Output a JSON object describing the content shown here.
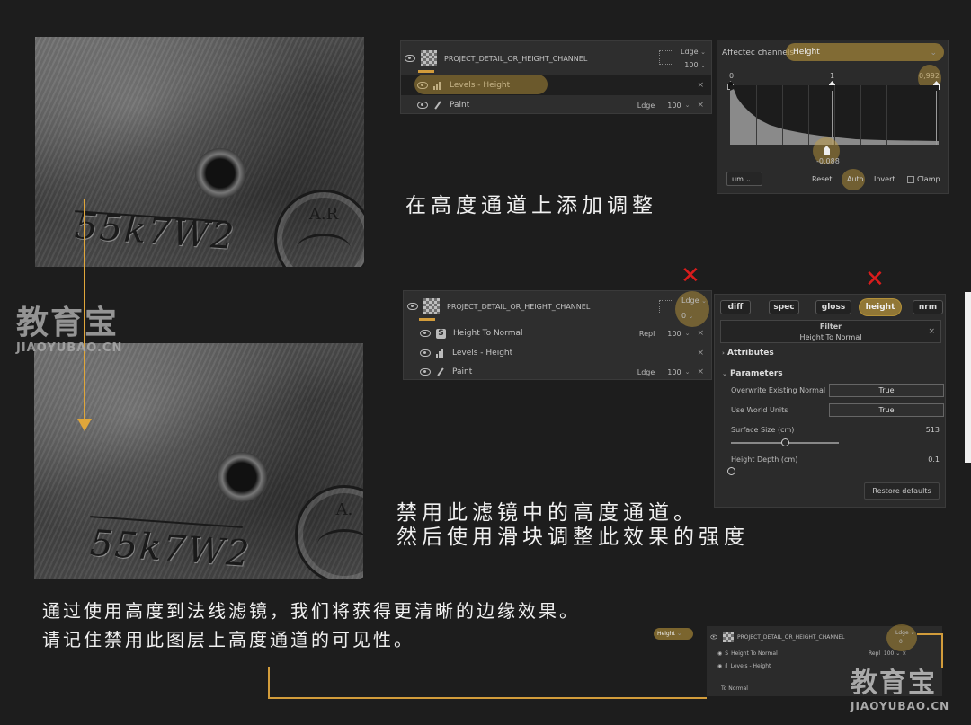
{
  "left_photo_top": {
    "stamp": "55k7W2",
    "seal": "A.R"
  },
  "left_photo_bottom": {
    "stamp": "55k7W2",
    "seal": "A."
  },
  "watermark": {
    "brand_cn": "教育宝",
    "brand_url": "JIAOYUBAO.CN"
  },
  "layers_top": {
    "layer_name": "PROJECT_DETAIL_OR_HEIGHT_CHANNEL",
    "blend": "Ldge",
    "opacity": "100",
    "rows": [
      {
        "label": "Levels - Height"
      },
      {
        "label": "Paint",
        "blend": "Ldge",
        "opacity": "100"
      }
    ]
  },
  "levels": {
    "affected_label": "Affectec channels",
    "channel": "Height",
    "tick_left": "0",
    "tick_mid": "1",
    "tick_right": "0,992",
    "bottom_value": "-0,088",
    "dropdown": "um",
    "reset": "Reset",
    "auto": "Auto",
    "invert": "Invert",
    "clamp": "Clamp"
  },
  "caption_1": "在高度通道上添加调整",
  "layers_mid": {
    "layer_name": "PROJECT_DETAIL_OR_HEIGHT_CHANNEL",
    "blend": "Ldge",
    "opacity": "0",
    "rows": [
      {
        "label": "Height To Normal",
        "blend": "Repl",
        "opacity": "100"
      },
      {
        "label": "Levels - Height"
      },
      {
        "label": "Paint",
        "blend": "Ldge",
        "opacity": "100"
      }
    ]
  },
  "filter": {
    "tabs": [
      "diff",
      "spec",
      "gloss",
      "height",
      "nrm"
    ],
    "header_title": "Filter",
    "header_sub": "Height To Normal",
    "attributes": "Attributes",
    "parameters": "Parameters",
    "overwrite_label": "Overwrite Existing Normal",
    "overwrite_value": "True",
    "world_label": "Use World Units",
    "world_value": "True",
    "surface_label": "Surface Size (cm)",
    "surface_value": "513",
    "surface_fraction": 0.5,
    "depth_label": "Height Depth (cm)",
    "depth_value": "0.1",
    "depth_fraction": 0.0,
    "restore": "Restore defaults"
  },
  "caption_2_line1": "禁用此滤镜中的高度通道。",
  "caption_2_line2": "然后使用滑块调整此效果的强度",
  "caption_3_line1": "通过使用高度到法线滤镜，我们将获得更清晰的边缘效果。",
  "caption_3_line2": "请记住禁用此图层上高度通道的可见性。",
  "mini": {
    "channel": "Height",
    "layer_name": "PROJECT_DETAIL_OR_HEIGHT_CHANNEL",
    "blend": "Ldge",
    "opacity": "0",
    "row1": "Height To Normal",
    "row1_blend": "Repl",
    "row1_opacity": "100",
    "row2": "Levels - Height",
    "footer": "To Normal"
  },
  "colors": {
    "accent": "#d29c3b",
    "red_mark": "#d91c1c",
    "bg": "#1d1d1d"
  }
}
